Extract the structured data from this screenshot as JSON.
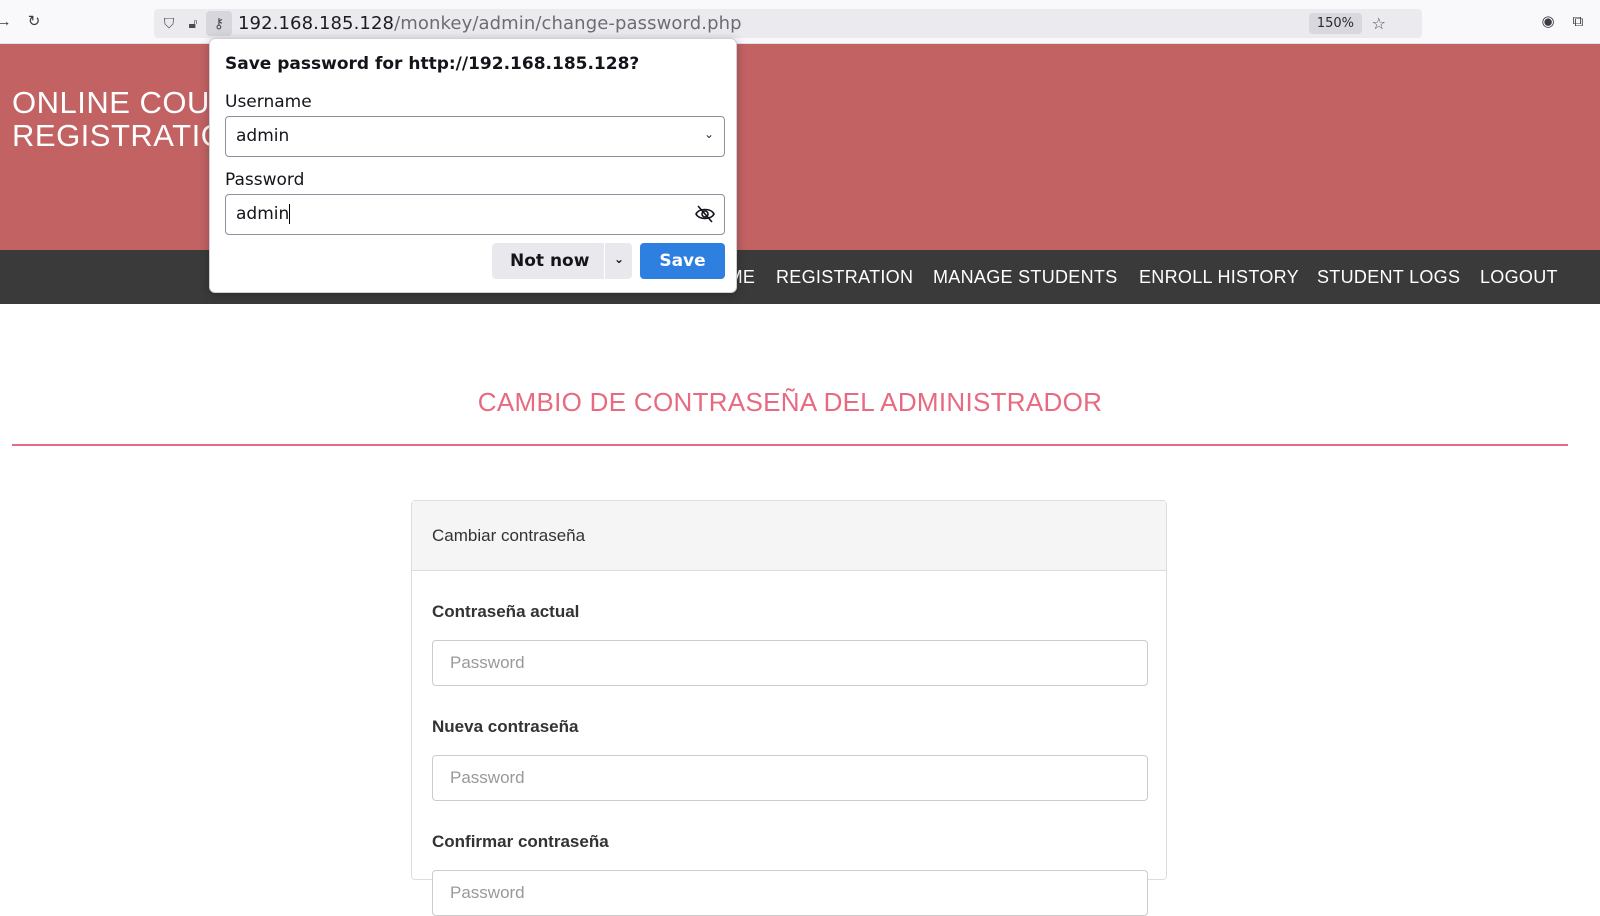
{
  "browser": {
    "url_host": "192.168.185.128",
    "url_path": "/monkey/admin/change-password.php",
    "zoom": "150%"
  },
  "site": {
    "brand_line1": "ONLINE COURSE",
    "brand_line2": "REGISTRATION",
    "nav": [
      "HOME",
      "REGISTRATION",
      "MANAGE STUDENTS",
      "ENROLL HISTORY",
      "STUDENT LOGS",
      "LOGOUT"
    ]
  },
  "page": {
    "title": "CAMBIO DE CONTRASEÑA DEL ADMINISTRADOR",
    "panel_heading": "Cambiar contraseña",
    "fields": [
      {
        "label": "Contraseña actual",
        "placeholder": "Password"
      },
      {
        "label": "Nueva contraseña",
        "placeholder": "Password"
      },
      {
        "label": "Confirmar contraseña",
        "placeholder": "Password"
      }
    ]
  },
  "popup": {
    "title": "Save password for http://192.168.185.128?",
    "username_label": "Username",
    "username_value": "admin",
    "password_label": "Password",
    "password_value": "admin",
    "not_now": "Not now",
    "save": "Save"
  }
}
